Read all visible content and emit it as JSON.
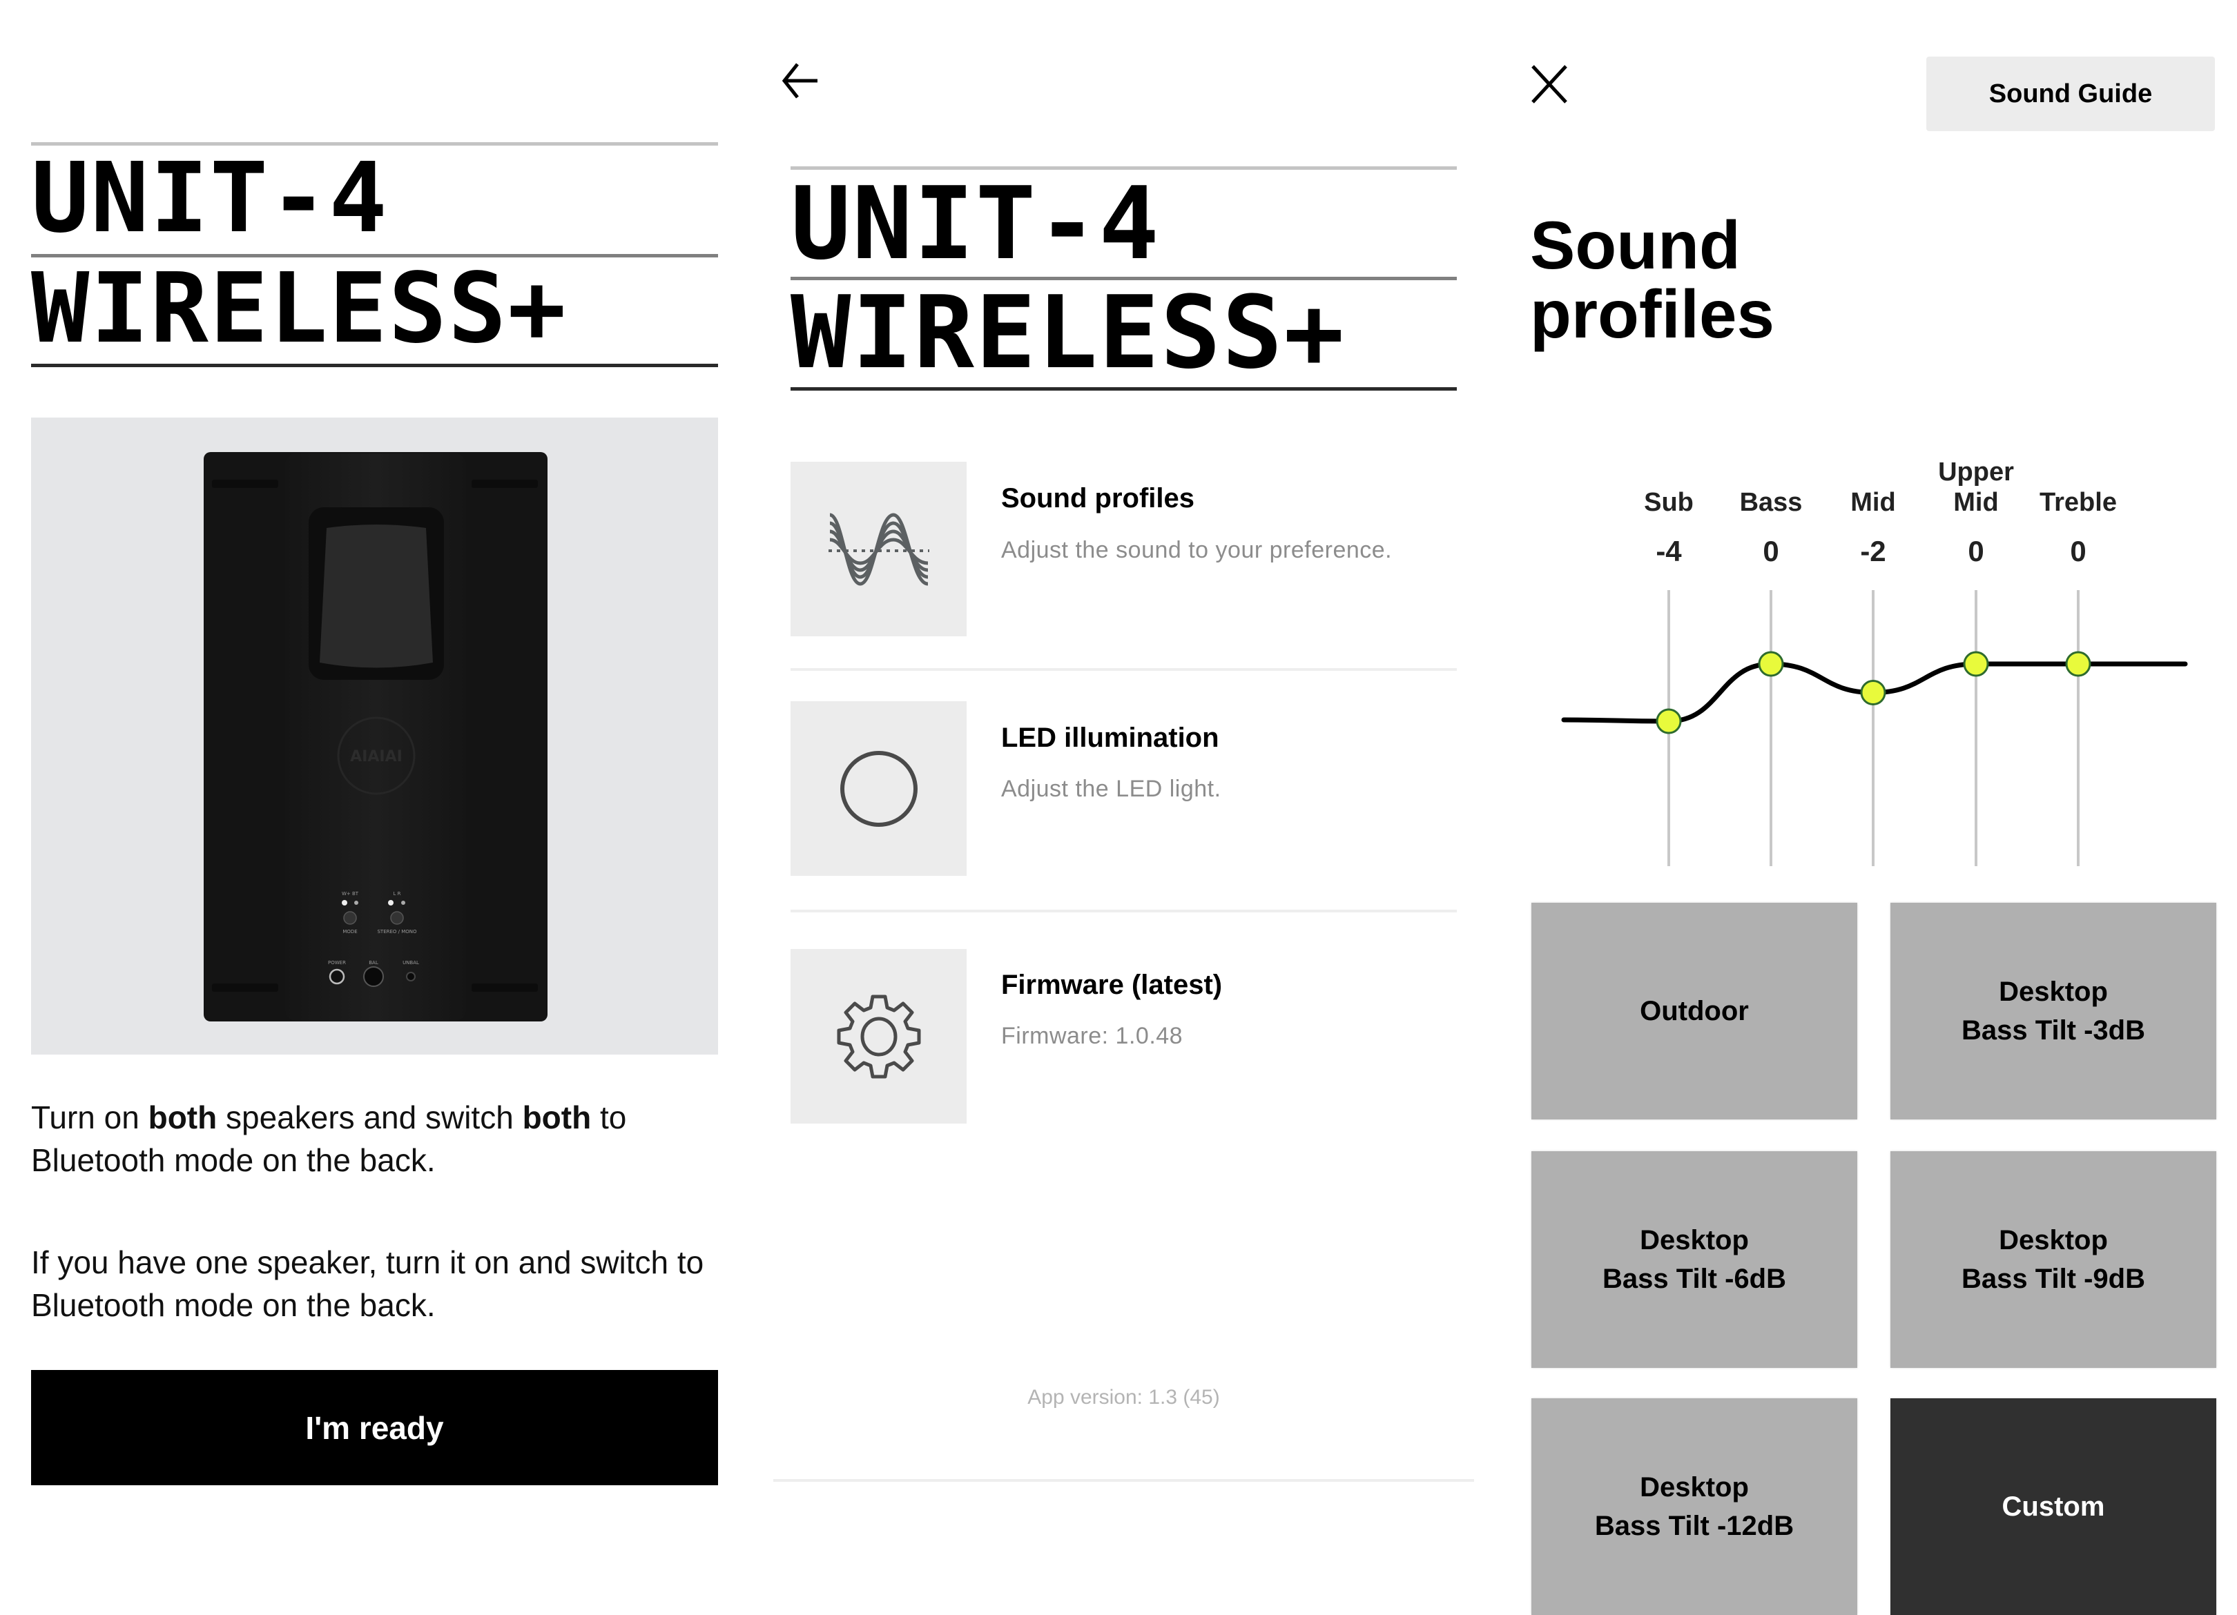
{
  "onboarding": {
    "brand_line1": "UNIT-4",
    "brand_line2": "WIRELESS+",
    "speaker_image_alt": "Back of speaker",
    "speaker_labels": {
      "led_left": "W+ BT",
      "led_right": "L R",
      "button_mode": "MODE",
      "button_stereo": "STEREO / MONO",
      "port_power": "POWER",
      "port_bal": "BAL",
      "port_unbal": "UNBAL"
    },
    "para1_a": "Turn on ",
    "para1_b": "both",
    "para1_c": " speakers and switch ",
    "para1_d": "both",
    "para1_e": " to Bluetooth mode on the back.",
    "para2": "If you have one speaker, turn it on and switch to Bluetooth mode on the back.",
    "ready_button": "I'm ready"
  },
  "settings": {
    "brand_line1": "UNIT-4",
    "brand_line2": "WIRELESS+",
    "items": [
      {
        "icon": "waveform-icon",
        "title": "Sound profiles",
        "desc": "Adjust the sound to your preference."
      },
      {
        "icon": "circle-icon",
        "title": "LED illumination",
        "desc": "Adjust the LED light."
      },
      {
        "icon": "gear-icon",
        "title": "Firmware (latest)",
        "desc": "Firmware: 1.0.48"
      }
    ],
    "app_version": "App version: 1.3 (45)"
  },
  "sound_profiles": {
    "guide_button": "Sound Guide",
    "title_line1": "Sound",
    "title_line2": "profiles",
    "accent_color": "#e8fa3c",
    "accent_border": "#2e6b2e",
    "presets": [
      {
        "line1": "Outdoor",
        "line2": "",
        "active": false
      },
      {
        "line1": "Desktop",
        "line2": "Bass Tilt -3dB",
        "active": false
      },
      {
        "line1": "Desktop",
        "line2": "Bass Tilt -6dB",
        "active": false
      },
      {
        "line1": "Desktop",
        "line2": "Bass Tilt -9dB",
        "active": false
      },
      {
        "line1": "Desktop",
        "line2": "Bass Tilt -12dB",
        "active": false
      },
      {
        "line1": "Custom",
        "line2": "",
        "active": true
      }
    ]
  },
  "chart_data": {
    "type": "line",
    "title": "",
    "categories": [
      "Sub",
      "Bass",
      "Mid",
      "Upper Mid",
      "Treble"
    ],
    "category_labels": [
      [
        "",
        "Sub"
      ],
      [
        "",
        "Bass"
      ],
      [
        "",
        "Mid"
      ],
      [
        "Upper",
        "Mid"
      ],
      [
        "",
        "Treble"
      ]
    ],
    "values": [
      -4,
      0,
      -2,
      0,
      0
    ],
    "value_labels": [
      "-4",
      "0",
      "-2",
      "0",
      "0"
    ],
    "xlabel": "",
    "ylabel": "",
    "ylim": [
      -12,
      12
    ],
    "grid": false,
    "legend": "none"
  }
}
